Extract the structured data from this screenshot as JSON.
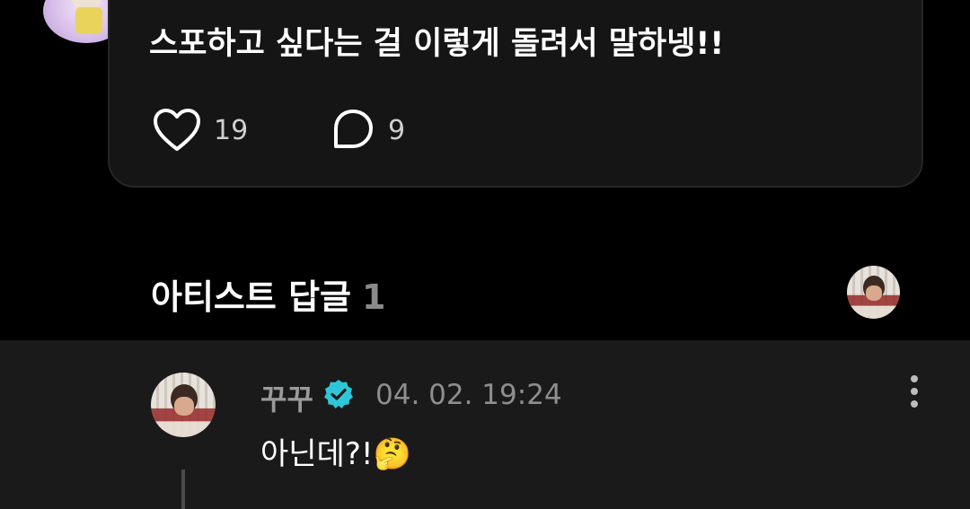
{
  "post": {
    "text": "스포하고 싶다는 걸 이렇게 돌려서 말하넹!!",
    "likes": "19",
    "comments": "9"
  },
  "artist_replies": {
    "title": "아티스트 답글",
    "count": "1"
  },
  "reply": {
    "author": "꾸꾸",
    "timestamp": "04. 02. 19:24",
    "text": "아닌데?!🤔"
  },
  "icons": {
    "like": "heart-outline-icon",
    "comment": "speech-bubble-icon",
    "verified": "verified-badge-icon",
    "more": "more-vertical-icon"
  },
  "colors": {
    "background": "#000000",
    "card": "#151515",
    "reply_panel": "#1a1a1a",
    "verified": "#2ec7d9"
  }
}
